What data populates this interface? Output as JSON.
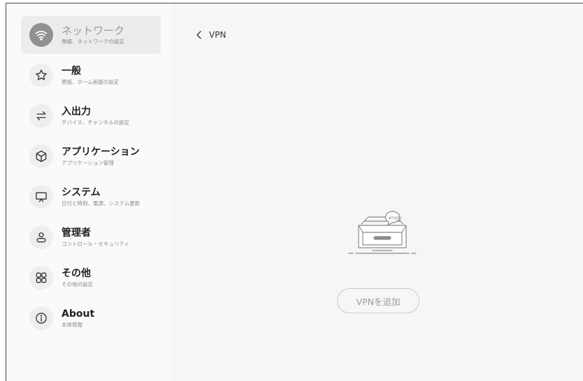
{
  "sidebar": {
    "items": [
      {
        "label": "ネットワーク",
        "sub": "無線、ネットワークの設定",
        "icon": "wifi-icon",
        "active": true
      },
      {
        "label": "一般",
        "sub": "壁紙、ホーム画面の設定",
        "icon": "star-icon"
      },
      {
        "label": "入出力",
        "sub": "デバイス、チャンネルの設定",
        "icon": "swap-arrows-icon"
      },
      {
        "label": "アプリケーション",
        "sub": "アプリケーション管理",
        "icon": "cube-icon"
      },
      {
        "label": "システム",
        "sub": "日付と時刻、電源、システム更新",
        "icon": "monitor-icon"
      },
      {
        "label": "管理者",
        "sub": "コントロール・セキュリティ",
        "icon": "user-icon"
      },
      {
        "label": "その他",
        "sub": "その他の設定",
        "icon": "grid-icon"
      },
      {
        "label": "About",
        "sub": "本体情報",
        "icon": "info-icon"
      }
    ]
  },
  "main": {
    "title": "VPN",
    "empty_badge": "empty",
    "add_button": "VPNを追加"
  },
  "colors": {
    "sidebar_bg": "#fafafa",
    "main_bg": "#f6f6f6",
    "active_bg": "#ececec"
  }
}
